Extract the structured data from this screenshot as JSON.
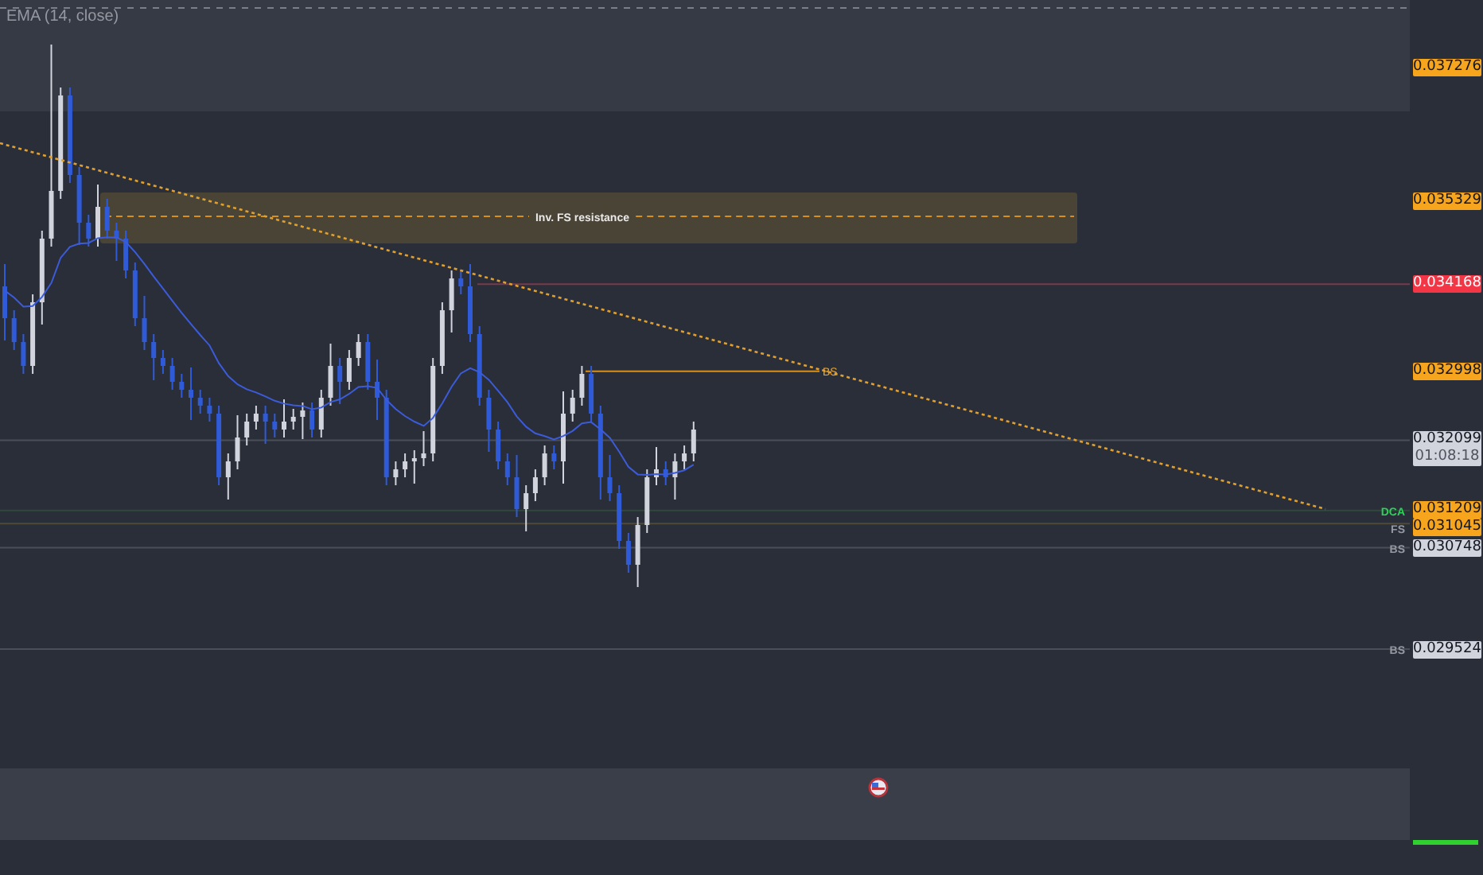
{
  "indicator_legend": "EMA (14, close)",
  "zone": {
    "label": "Inv. FS resistance"
  },
  "trend_marker": "BS",
  "price_labels": [
    {
      "price": "0.037276",
      "color": "#f7a51c"
    },
    {
      "price": "0.035329",
      "color": "#f7a51c"
    },
    {
      "price": "0.034168",
      "color": "#f23645"
    },
    {
      "price": "0.032998",
      "color": "#f7a51c"
    },
    {
      "price": "0.032099",
      "countdown": "01:08:18",
      "color": "#d1d4dc"
    },
    {
      "price": "0.031209",
      "marker": {
        "text": "DCA",
        "color": "#2fd15a"
      },
      "color": "#f7a51c"
    },
    {
      "price": "0.031045",
      "marker": {
        "text": "FS",
        "color": "#9598a1"
      },
      "color": "#f7a51c"
    },
    {
      "price": "0.030748",
      "marker": {
        "text": "BS",
        "color": "#9598a1"
      },
      "color": "#d1d4dc"
    },
    {
      "price": "0.029524",
      "marker": {
        "text": "BS",
        "color": "#9598a1"
      },
      "color": "#d1d4dc"
    }
  ]
}
